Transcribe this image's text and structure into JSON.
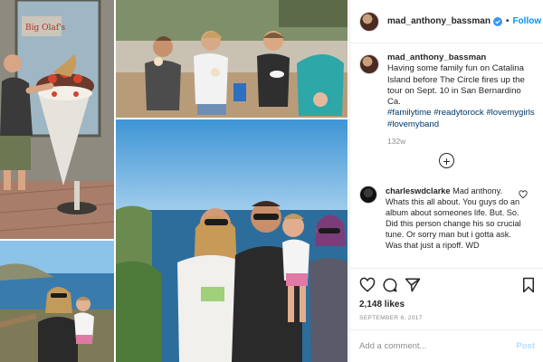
{
  "header": {
    "username": "mad_anthony_bassman",
    "separator": "•",
    "follow_label": "Follow"
  },
  "caption": {
    "username": "mad_anthony_bassman",
    "text": "Having some family fun on Catalina Island before The Circle fires up the tour on Sept. 10 in San Bernardino Ca.",
    "hashtags": [
      "#familytime",
      "#readytorock",
      "#lovemygirls",
      "#lovemyband"
    ],
    "time": "132w"
  },
  "comment": {
    "username": "charleswdclarke",
    "text": "Mad anthony. Whats this all about. You guys do an album about someones life. But. So. Did this person change his so crucial tune. Or sorry man but i gotta ask. Was that just a ripoff. WD"
  },
  "stats": {
    "likes": "2,148 likes",
    "date": "SEPTEMBER 6, 2017"
  },
  "add_comment": {
    "placeholder": "Add a comment...",
    "post_label": "Post"
  },
  "collage": {
    "photos": [
      {
        "name": "ice-cream-statue-photo",
        "shop_sign": "Big Olaf's"
      },
      {
        "name": "women-eating-ice-cream-photo"
      },
      {
        "name": "family-ocean-view-photo"
      },
      {
        "name": "mother-daughter-coast-photo"
      }
    ]
  },
  "icons": {
    "verified": "verified-badge-icon",
    "plus": "plus-circle-icon",
    "heart": "heart-icon",
    "comment": "comment-icon",
    "share": "share-icon",
    "save": "bookmark-icon"
  },
  "colors": {
    "link_blue": "#0095f6",
    "hashtag_blue": "#00376b",
    "muted_gray": "#8e8e8e",
    "post_disabled": "#b2dffc"
  }
}
